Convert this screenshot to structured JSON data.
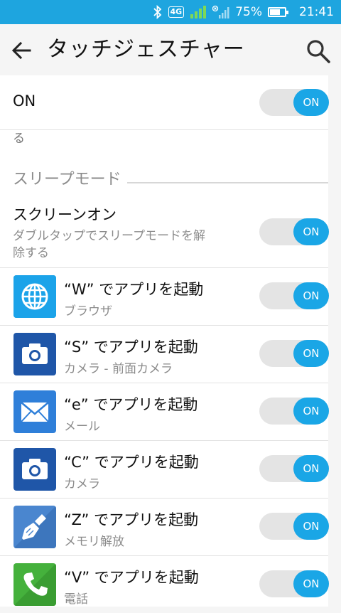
{
  "status_bar": {
    "network": "4G",
    "battery": "75%",
    "battery_level": 0.75,
    "time": "21:41",
    "icons": [
      "bluetooth-icon",
      "signal-4g-icon",
      "signal-icon",
      "battery-icon"
    ]
  },
  "app_bar": {
    "title": "タッチジェスチャー",
    "icons": [
      "back-arrow-icon",
      "search-icon"
    ]
  },
  "master": {
    "label": "ON",
    "toggle": "ON",
    "partial_text": "る"
  },
  "section": {
    "title": "スリープモード"
  },
  "screen_on": {
    "title": "スクリーンオン",
    "subtitle": "ダブルタップでスリープモードを解除する",
    "subtitle_line1": "ダブルタップでスリープモードを解",
    "subtitle_line2": "除する",
    "toggle": "ON"
  },
  "gestures": [
    {
      "title": "“W” でアプリを起動",
      "subtitle": "ブラウザ",
      "icon": "globe-icon",
      "toggle": "ON"
    },
    {
      "title": "“S” でアプリを起動",
      "subtitle": "カメラ - 前面カメラ",
      "icon": "camera-icon",
      "toggle": "ON"
    },
    {
      "title": "“e” でアプリを起動",
      "subtitle": "メール",
      "icon": "mail-icon",
      "toggle": "ON"
    },
    {
      "title": "“C” でアプリを起動",
      "subtitle": "カメラ",
      "icon": "camera-icon",
      "toggle": "ON"
    },
    {
      "title": "“Z” でアプリを起動",
      "subtitle": "メモリ解放",
      "icon": "broom-icon",
      "toggle": "ON"
    },
    {
      "title": "“V” でアプリを起動",
      "subtitle": "電話",
      "icon": "phone-icon",
      "toggle": "ON"
    }
  ],
  "colors": {
    "status_bar": "#1ea5df",
    "toggle_on": "#1aa6e6",
    "toggle_track": "#e4e4e4"
  }
}
